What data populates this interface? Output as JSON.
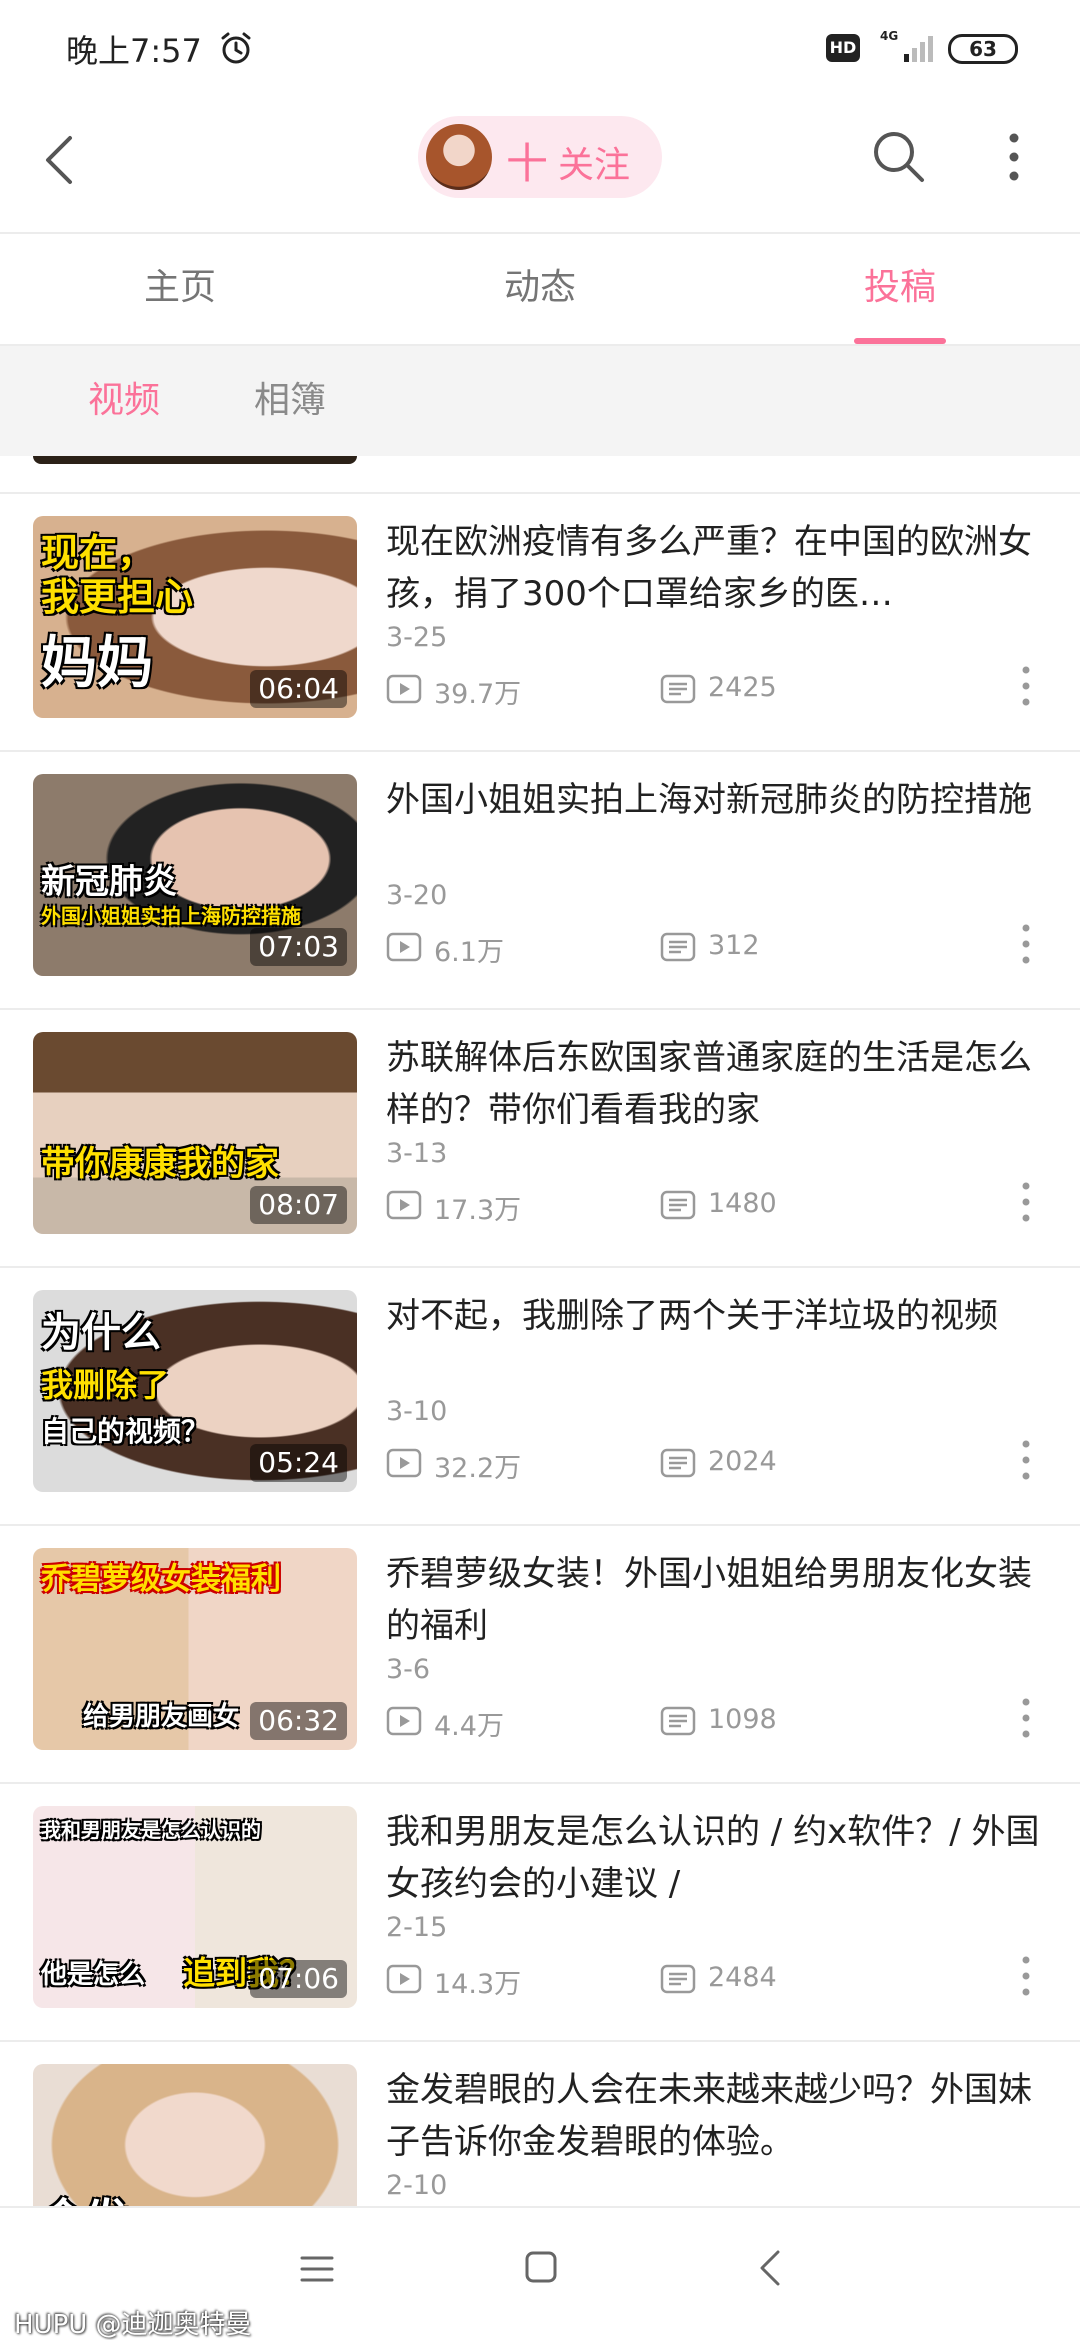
{
  "status_bar": {
    "time": "晚上7:57",
    "network_badge": "HD",
    "network_type": "4G",
    "battery": "63"
  },
  "header": {
    "follow_plus": "十",
    "follow_label": "关注"
  },
  "tabs": [
    {
      "label": "主页",
      "active": false
    },
    {
      "label": "动态",
      "active": false
    },
    {
      "label": "投稿",
      "active": true
    }
  ],
  "sub_tabs": [
    {
      "label": "视频",
      "active": true
    },
    {
      "label": "相簿",
      "active": false
    }
  ],
  "videos": [
    {
      "title": "现在欧洲疫情有多么严重？在中国的欧洲女孩，捐了300个口罩给家乡的医…",
      "date": "3-25",
      "views": "39.7万",
      "comments": "2425",
      "duration": "06:04",
      "thumb_text": [
        "现在，",
        "我更担心",
        "妈妈"
      ]
    },
    {
      "title": "外国小姐姐实拍上海对新冠肺炎的防控措施",
      "date": "3-20",
      "views": "6.1万",
      "comments": "312",
      "duration": "07:03",
      "thumb_text": [
        "新冠肺炎",
        "外国小姐姐实拍上海防控措施"
      ]
    },
    {
      "title": "苏联解体后东欧国家普通家庭的生活是怎么样的？带你们看看我的家",
      "date": "3-13",
      "views": "17.3万",
      "comments": "1480",
      "duration": "08:07",
      "thumb_text": [
        "带你康康我的家"
      ]
    },
    {
      "title": "对不起，我删除了两个关于洋垃圾的视频",
      "date": "3-10",
      "views": "32.2万",
      "comments": "2024",
      "duration": "05:24",
      "thumb_text": [
        "为什么",
        "我删除了",
        "自己的视频？"
      ]
    },
    {
      "title": "乔碧萝级女装！外国小姐姐给男朋友化女装的福利",
      "date": "3-6",
      "views": "4.4万",
      "comments": "1098",
      "duration": "06:32",
      "thumb_text": [
        "乔碧萝级女装福利",
        "给男朋友画女"
      ]
    },
    {
      "title": "我和男朋友是怎么认识的 / 约x软件？/ 外国女孩约会的小建议 /",
      "date": "2-15",
      "views": "14.3万",
      "comments": "2484",
      "duration": "07:06",
      "thumb_text": [
        "我和男朋友是怎么认识的",
        "他是怎么",
        "追到我？"
      ]
    },
    {
      "title": "金发碧眼的人会在未来越来越少吗？外国妹子告诉你金发碧眼的体验。",
      "date": "2-10",
      "views": "",
      "comments": "",
      "duration": "",
      "thumb_text": [
        "金发"
      ]
    }
  ],
  "watermark": "HUPU @迪迦奥特曼",
  "colors": {
    "accent": "#fb7299",
    "accent_bg": "#fde8ef",
    "meta_text": "#999999"
  }
}
